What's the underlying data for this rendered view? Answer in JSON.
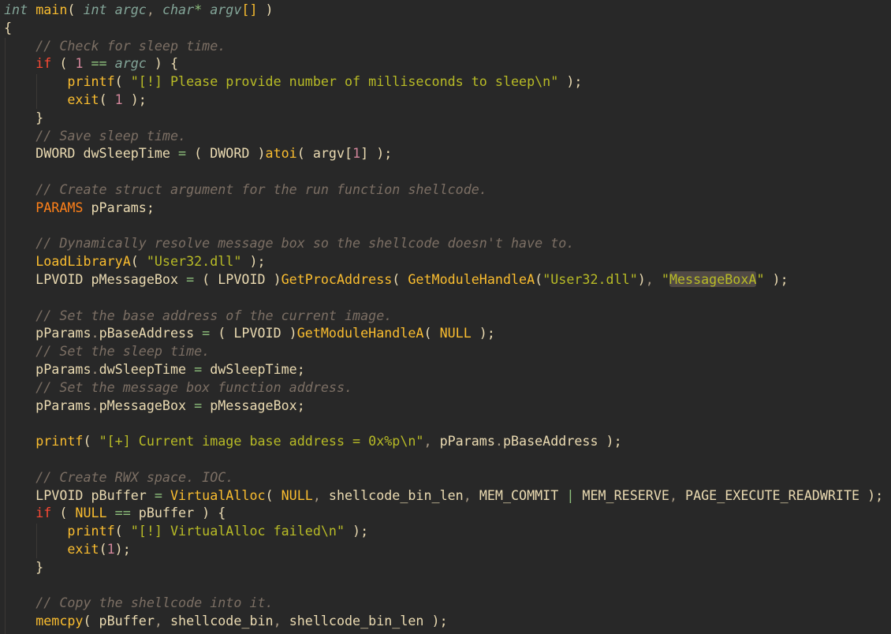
{
  "editor": {
    "theme_colors": {
      "background": "#282828",
      "text": "#ebdbb2",
      "keyword": "#83a598",
      "function": "#fabd2f",
      "string": "#b8bb26",
      "comment": "#7c6f64",
      "number": "#d3869b",
      "control": "#fb4934",
      "type": "#fe8019",
      "operator": "#8ec07c",
      "highlight": "#504945"
    },
    "lines": [
      [
        {
          "c": "kw",
          "t": "int"
        },
        {
          "c": "pl",
          "t": " "
        },
        {
          "c": "fn",
          "t": "main"
        },
        {
          "c": "pl",
          "t": "( "
        },
        {
          "c": "kw",
          "t": "int argc"
        },
        {
          "c": "pun",
          "t": ", "
        },
        {
          "c": "kw",
          "t": "char"
        },
        {
          "c": "op",
          "t": "*"
        },
        {
          "c": "pl",
          "t": " "
        },
        {
          "c": "kw",
          "t": "argv"
        },
        {
          "c": "br",
          "t": "[]"
        },
        {
          "c": "pl",
          "t": " )"
        }
      ],
      [
        {
          "c": "pl",
          "t": "{"
        }
      ],
      [
        {
          "c": "pl",
          "t": "    "
        },
        {
          "c": "cm",
          "t": "// Check for sleep time."
        }
      ],
      [
        {
          "c": "pl",
          "t": "    "
        },
        {
          "c": "ctl",
          "t": "if"
        },
        {
          "c": "pl",
          "t": " ( "
        },
        {
          "c": "num",
          "t": "1"
        },
        {
          "c": "pl",
          "t": " "
        },
        {
          "c": "op",
          "t": "=="
        },
        {
          "c": "pl",
          "t": " "
        },
        {
          "c": "kw",
          "t": "argc"
        },
        {
          "c": "pl",
          "t": " ) {"
        }
      ],
      [
        {
          "c": "pl",
          "t": "        "
        },
        {
          "c": "fn",
          "t": "printf"
        },
        {
          "c": "pl",
          "t": "( "
        },
        {
          "c": "str",
          "t": "\"[!] Please provide number of milliseconds to sleep\\n\""
        },
        {
          "c": "pl",
          "t": " );"
        }
      ],
      [
        {
          "c": "pl",
          "t": "        "
        },
        {
          "c": "fn",
          "t": "exit"
        },
        {
          "c": "pl",
          "t": "( "
        },
        {
          "c": "num",
          "t": "1"
        },
        {
          "c": "pl",
          "t": " );"
        }
      ],
      [
        {
          "c": "pl",
          "t": "    }"
        }
      ],
      [
        {
          "c": "pl",
          "t": "    "
        },
        {
          "c": "cm",
          "t": "// Save sleep time."
        }
      ],
      [
        {
          "c": "pl",
          "t": "    DWORD dwSleepTime "
        },
        {
          "c": "op",
          "t": "="
        },
        {
          "c": "pl",
          "t": " ( DWORD )"
        },
        {
          "c": "fn",
          "t": "atoi"
        },
        {
          "c": "pl",
          "t": "( argv["
        },
        {
          "c": "num",
          "t": "1"
        },
        {
          "c": "pl",
          "t": "] );"
        }
      ],
      [],
      [
        {
          "c": "pl",
          "t": "    "
        },
        {
          "c": "cm",
          "t": "// Create struct argument for the run function shellcode."
        }
      ],
      [
        {
          "c": "pl",
          "t": "    "
        },
        {
          "c": "ty",
          "t": "PARAMS"
        },
        {
          "c": "pl",
          "t": " pParams;"
        }
      ],
      [],
      [
        {
          "c": "pl",
          "t": "    "
        },
        {
          "c": "cm",
          "t": "// Dynamically resolve message box so the shellcode doesn't have to."
        }
      ],
      [
        {
          "c": "pl",
          "t": "    "
        },
        {
          "c": "fn",
          "t": "LoadLibraryA"
        },
        {
          "c": "pl",
          "t": "( "
        },
        {
          "c": "str",
          "t": "\"User32.dll\""
        },
        {
          "c": "pl",
          "t": " );"
        }
      ],
      [
        {
          "c": "pl",
          "t": "    LPVOID pMessageBox "
        },
        {
          "c": "op",
          "t": "="
        },
        {
          "c": "pl",
          "t": " ( LPVOID )"
        },
        {
          "c": "fn",
          "t": "GetProcAddress"
        },
        {
          "c": "pl",
          "t": "( "
        },
        {
          "c": "fn",
          "t": "GetModuleHandleA"
        },
        {
          "c": "pl",
          "t": "("
        },
        {
          "c": "str",
          "t": "\"User32.dll\""
        },
        {
          "c": "pl",
          "t": ")"
        },
        {
          "c": "pun",
          "t": ", "
        },
        {
          "c": "str",
          "t": "\""
        },
        {
          "c": "str hl",
          "t": "MessageBoxA"
        },
        {
          "c": "str",
          "t": "\""
        },
        {
          "c": "pl",
          "t": " );"
        }
      ],
      [],
      [
        {
          "c": "pl",
          "t": "    "
        },
        {
          "c": "cm",
          "t": "// Set the base address of the current image."
        }
      ],
      [
        {
          "c": "pl",
          "t": "    pParams"
        },
        {
          "c": "pun",
          "t": "."
        },
        {
          "c": "pl",
          "t": "pBaseAddress "
        },
        {
          "c": "op",
          "t": "="
        },
        {
          "c": "pl",
          "t": " ( LPVOID )"
        },
        {
          "c": "fn",
          "t": "GetModuleHandleA"
        },
        {
          "c": "pl",
          "t": "( "
        },
        {
          "c": "fn",
          "t": "NULL"
        },
        {
          "c": "pl",
          "t": " );"
        }
      ],
      [
        {
          "c": "pl",
          "t": "    "
        },
        {
          "c": "cm",
          "t": "// Set the sleep time."
        }
      ],
      [
        {
          "c": "pl",
          "t": "    pParams"
        },
        {
          "c": "pun",
          "t": "."
        },
        {
          "c": "pl",
          "t": "dwSleepTime "
        },
        {
          "c": "op",
          "t": "="
        },
        {
          "c": "pl",
          "t": " dwSleepTime;"
        }
      ],
      [
        {
          "c": "pl",
          "t": "    "
        },
        {
          "c": "cm",
          "t": "// Set the message box function address."
        }
      ],
      [
        {
          "c": "pl",
          "t": "    pParams"
        },
        {
          "c": "pun",
          "t": "."
        },
        {
          "c": "pl",
          "t": "pMessageBox "
        },
        {
          "c": "op",
          "t": "="
        },
        {
          "c": "pl",
          "t": " pMessageBox;"
        }
      ],
      [],
      [
        {
          "c": "pl",
          "t": "    "
        },
        {
          "c": "fn",
          "t": "printf"
        },
        {
          "c": "pl",
          "t": "( "
        },
        {
          "c": "str",
          "t": "\"[+] Current image base address = 0x%p\\n\""
        },
        {
          "c": "pun",
          "t": ", "
        },
        {
          "c": "pl",
          "t": "pParams"
        },
        {
          "c": "pun",
          "t": "."
        },
        {
          "c": "pl",
          "t": "pBaseAddress );"
        }
      ],
      [],
      [
        {
          "c": "pl",
          "t": "    "
        },
        {
          "c": "cm",
          "t": "// Create RWX space. IOC."
        }
      ],
      [
        {
          "c": "pl",
          "t": "    LPVOID pBuffer "
        },
        {
          "c": "op",
          "t": "="
        },
        {
          "c": "pl",
          "t": " "
        },
        {
          "c": "fn",
          "t": "VirtualAlloc"
        },
        {
          "c": "pl",
          "t": "( "
        },
        {
          "c": "fn",
          "t": "NULL"
        },
        {
          "c": "pun",
          "t": ", "
        },
        {
          "c": "pl",
          "t": "shellcode_bin_len"
        },
        {
          "c": "pun",
          "t": ", "
        },
        {
          "c": "pl",
          "t": "MEM_COMMIT "
        },
        {
          "c": "op",
          "t": "|"
        },
        {
          "c": "pl",
          "t": " MEM_RESERVE"
        },
        {
          "c": "pun",
          "t": ", "
        },
        {
          "c": "pl",
          "t": "PAGE_EXECUTE_READWRITE );"
        }
      ],
      [
        {
          "c": "pl",
          "t": "    "
        },
        {
          "c": "ctl",
          "t": "if"
        },
        {
          "c": "pl",
          "t": " ( "
        },
        {
          "c": "fn",
          "t": "NULL"
        },
        {
          "c": "pl",
          "t": " "
        },
        {
          "c": "op",
          "t": "=="
        },
        {
          "c": "pl",
          "t": " pBuffer ) {"
        }
      ],
      [
        {
          "c": "pl",
          "t": "        "
        },
        {
          "c": "fn",
          "t": "printf"
        },
        {
          "c": "pl",
          "t": "( "
        },
        {
          "c": "str",
          "t": "\"[!] VirtualAlloc failed\\n\""
        },
        {
          "c": "pl",
          "t": " );"
        }
      ],
      [
        {
          "c": "pl",
          "t": "        "
        },
        {
          "c": "fn",
          "t": "exit"
        },
        {
          "c": "pl",
          "t": "("
        },
        {
          "c": "num",
          "t": "1"
        },
        {
          "c": "pl",
          "t": ");"
        }
      ],
      [
        {
          "c": "pl",
          "t": "    }"
        }
      ],
      [],
      [
        {
          "c": "pl",
          "t": "    "
        },
        {
          "c": "cm",
          "t": "// Copy the shellcode into it."
        }
      ],
      [
        {
          "c": "pl",
          "t": "    "
        },
        {
          "c": "fn",
          "t": "memcpy"
        },
        {
          "c": "pl",
          "t": "( pBuffer"
        },
        {
          "c": "pun",
          "t": ", "
        },
        {
          "c": "pl",
          "t": "shellcode_bin"
        },
        {
          "c": "pun",
          "t": ", "
        },
        {
          "c": "pl",
          "t": "shellcode_bin_len );"
        }
      ]
    ]
  }
}
